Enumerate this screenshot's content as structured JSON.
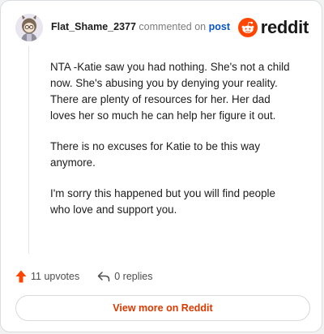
{
  "colors": {
    "accent": "#d93a00",
    "reddit_orange": "#ff4500",
    "link_blue": "#0a55c6",
    "upvote": "#ff4500"
  },
  "header": {
    "username": "Flat_Shame_2377",
    "action_text": "commented on",
    "post_link": "post",
    "brand_word": "reddit",
    "brand_icon": "reddit-snoo-icon"
  },
  "comment": {
    "paragraphs": [
      "NTA -Katie saw you had nothing. She's not a child now. She's abusing you by denying your reality. There are plenty of resources for her. Her dad loves her so much he can help her figure it out.",
      "There is no excuses for Katie to be this way anymore.",
      "I'm sorry this happened but you will find people who love and support you."
    ]
  },
  "footer": {
    "upvotes_label": "11 upvotes",
    "upvote_icon": "upvote-arrow-icon",
    "replies_label": "0 replies",
    "reply_icon": "reply-arrow-icon"
  },
  "cta": {
    "label": "View more on Reddit"
  }
}
